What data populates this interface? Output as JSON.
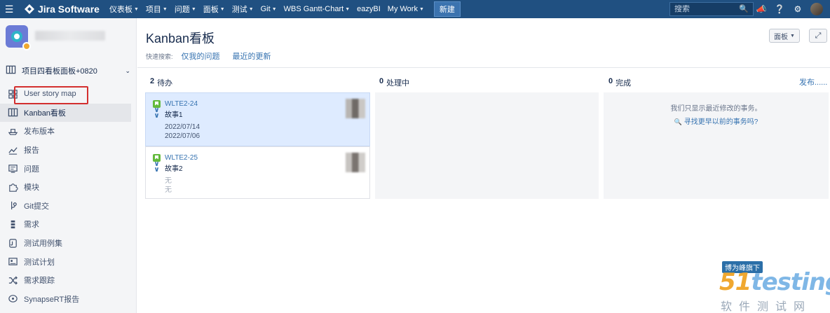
{
  "topbar": {
    "brand": "Jira Software",
    "nav": [
      {
        "label": "仪表板",
        "caret": true
      },
      {
        "label": "项目",
        "caret": true
      },
      {
        "label": "问题",
        "caret": true
      },
      {
        "label": "面板",
        "caret": true
      },
      {
        "label": "测试",
        "caret": true
      },
      {
        "label": "Git",
        "caret": true
      },
      {
        "label": "WBS Gantt-Chart",
        "caret": true
      },
      {
        "label": "eazyBI",
        "caret": false
      },
      {
        "label": "My Work",
        "caret": true
      }
    ],
    "create_label": "新建",
    "search_placeholder": "搜索",
    "icons": [
      "menu-icon",
      "jira-logo-icon",
      "search-icon",
      "notification-icon",
      "help-icon",
      "gear-icon",
      "user-avatar"
    ]
  },
  "sidebar": {
    "board_selector": "项目四看板面板+0820",
    "items": [
      {
        "label": "User story map",
        "icon": "story-map-icon",
        "active": false
      },
      {
        "label": "Kanban看板",
        "icon": "board-icon",
        "active": true
      },
      {
        "label": "发布版本",
        "icon": "ship-icon",
        "active": false
      },
      {
        "label": "报告",
        "icon": "chart-icon",
        "active": false
      },
      {
        "label": "问题",
        "icon": "issues-icon",
        "active": false
      },
      {
        "label": "模块",
        "icon": "puzzle-icon",
        "active": false
      },
      {
        "label": "Git提交",
        "icon": "git-icon",
        "active": false
      },
      {
        "label": "需求",
        "icon": "requirements-icon",
        "active": false
      },
      {
        "label": "测试用例集",
        "icon": "test-case-icon",
        "active": false
      },
      {
        "label": "测试计划",
        "icon": "test-plan-icon",
        "active": false
      },
      {
        "label": "需求跟踪",
        "icon": "shuffle-icon",
        "active": false
      },
      {
        "label": "SynapseRT报告",
        "icon": "report-icon",
        "active": false
      }
    ]
  },
  "header": {
    "title": "Kanban看板",
    "quick_filter_label": "快速搜索:",
    "quick_filters": [
      "仅我的问题",
      "最近的更新"
    ],
    "board_button": "面板",
    "fullscreen_icon": "expand-icon"
  },
  "columns": [
    {
      "count": "2",
      "name": "待办"
    },
    {
      "count": "0",
      "name": "处理中"
    },
    {
      "count": "0",
      "name": "完成"
    }
  ],
  "release_link": "发布......",
  "cards": [
    {
      "key": "WLTE2-24",
      "summary": "故事1",
      "dates": [
        "2022/07/14",
        "2022/07/06"
      ],
      "selected": true
    },
    {
      "key": "WLTE2-25",
      "summary": "故事2",
      "dates": [
        "无",
        "无"
      ],
      "selected": false
    }
  ],
  "done_column": {
    "message": "我们只显示最近修改的事务。",
    "link": "寻找更早以前的事务吗?"
  },
  "watermark": {
    "tag": "博为峰旗下",
    "logo_prefix": "51",
    "logo_text": "testing",
    "sub": "软件测试网"
  }
}
